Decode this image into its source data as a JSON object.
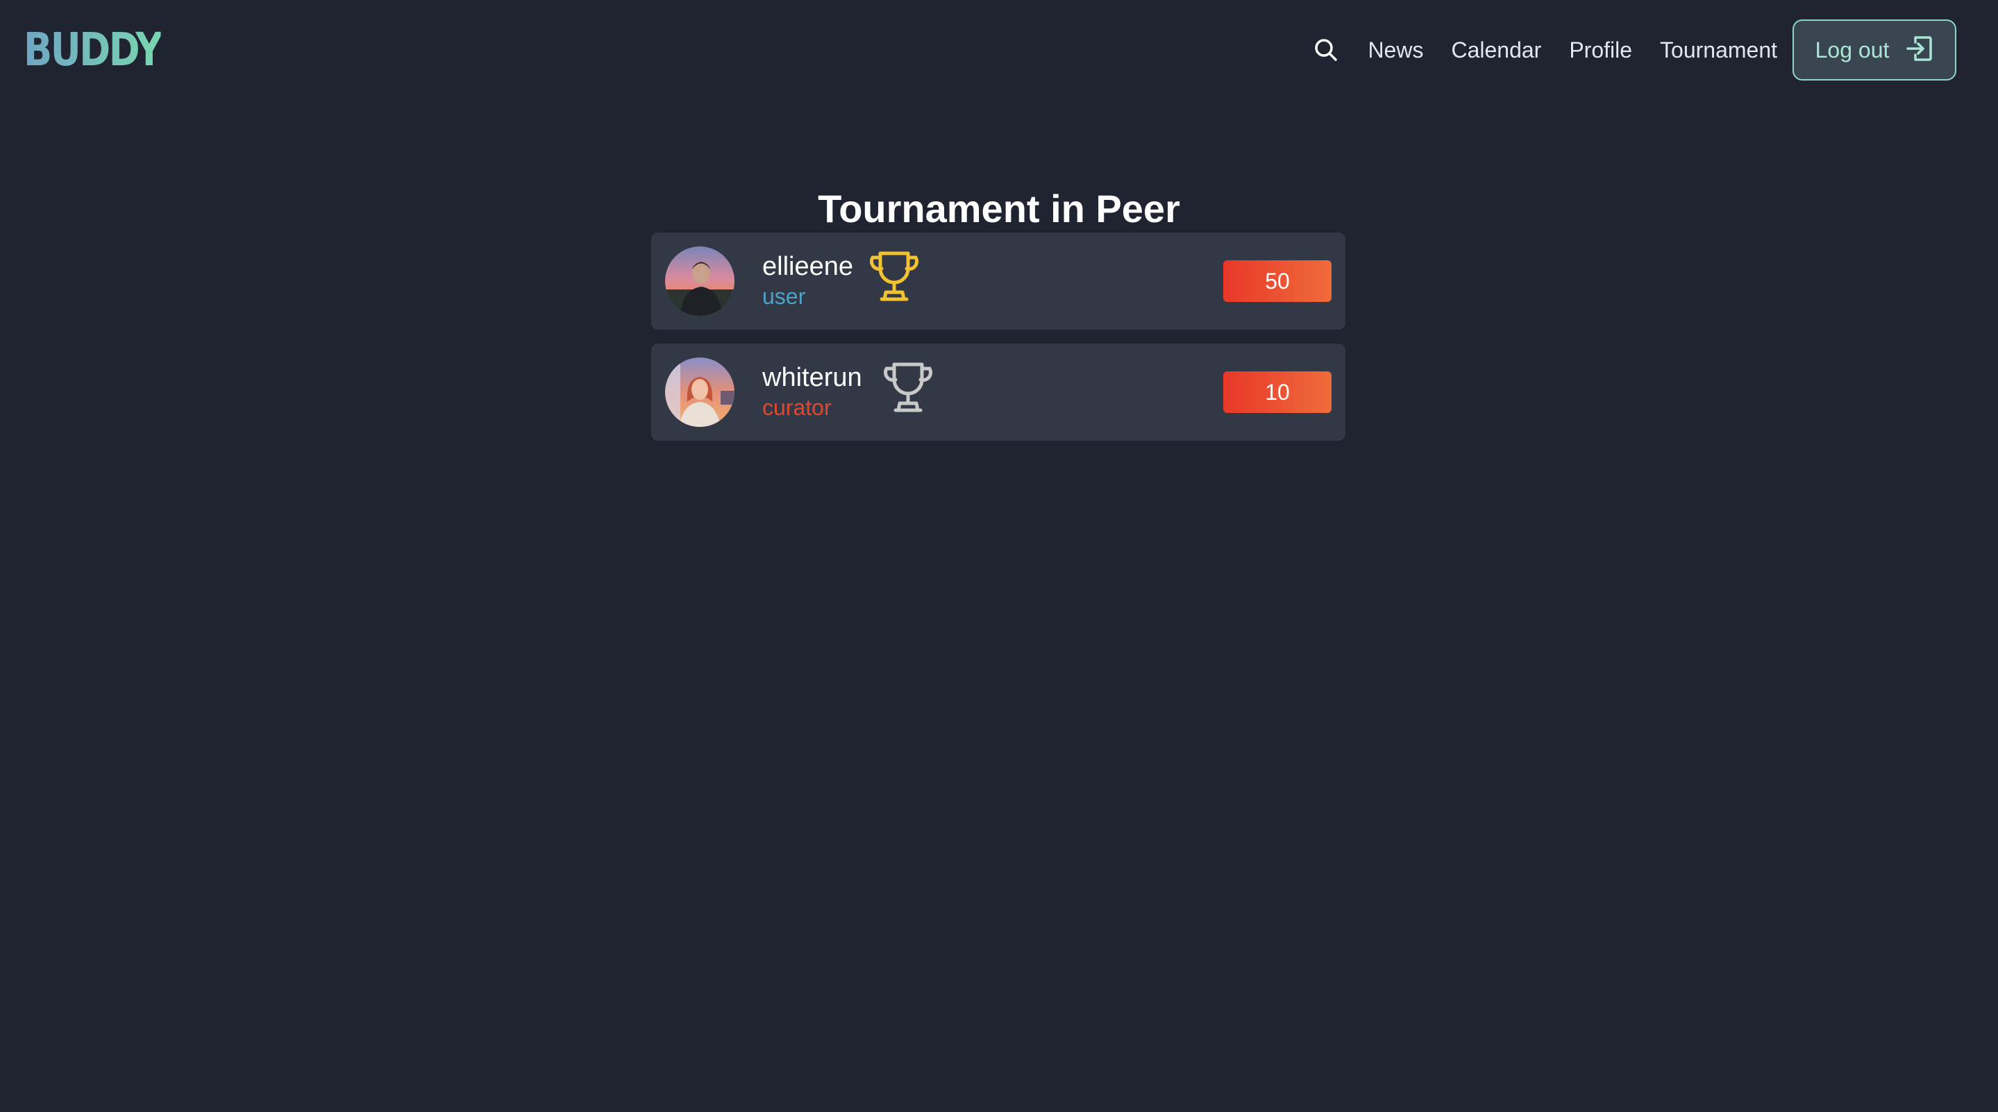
{
  "brand": {
    "logo_text": "BUDDY"
  },
  "nav": {
    "links": [
      "News",
      "Calendar",
      "Profile",
      "Tournament"
    ],
    "logout_label": "Log out"
  },
  "page": {
    "title": "Tournament in Peer"
  },
  "players": [
    {
      "username": "ellieene",
      "role": "user",
      "role_color": "#4aa3c8",
      "trophy": "gold-trophy-icon",
      "score": "50"
    },
    {
      "username": "whiterun",
      "role": "curator",
      "role_color": "#e0482f",
      "trophy": "silver-trophy-icon",
      "score": "10"
    }
  ],
  "colors": {
    "background": "#1f2430",
    "card": "#323846",
    "accent": "#8fd6c3",
    "score_badge": "#e8382a",
    "gold": "#f2c230",
    "silver": "#c9c9c9"
  }
}
